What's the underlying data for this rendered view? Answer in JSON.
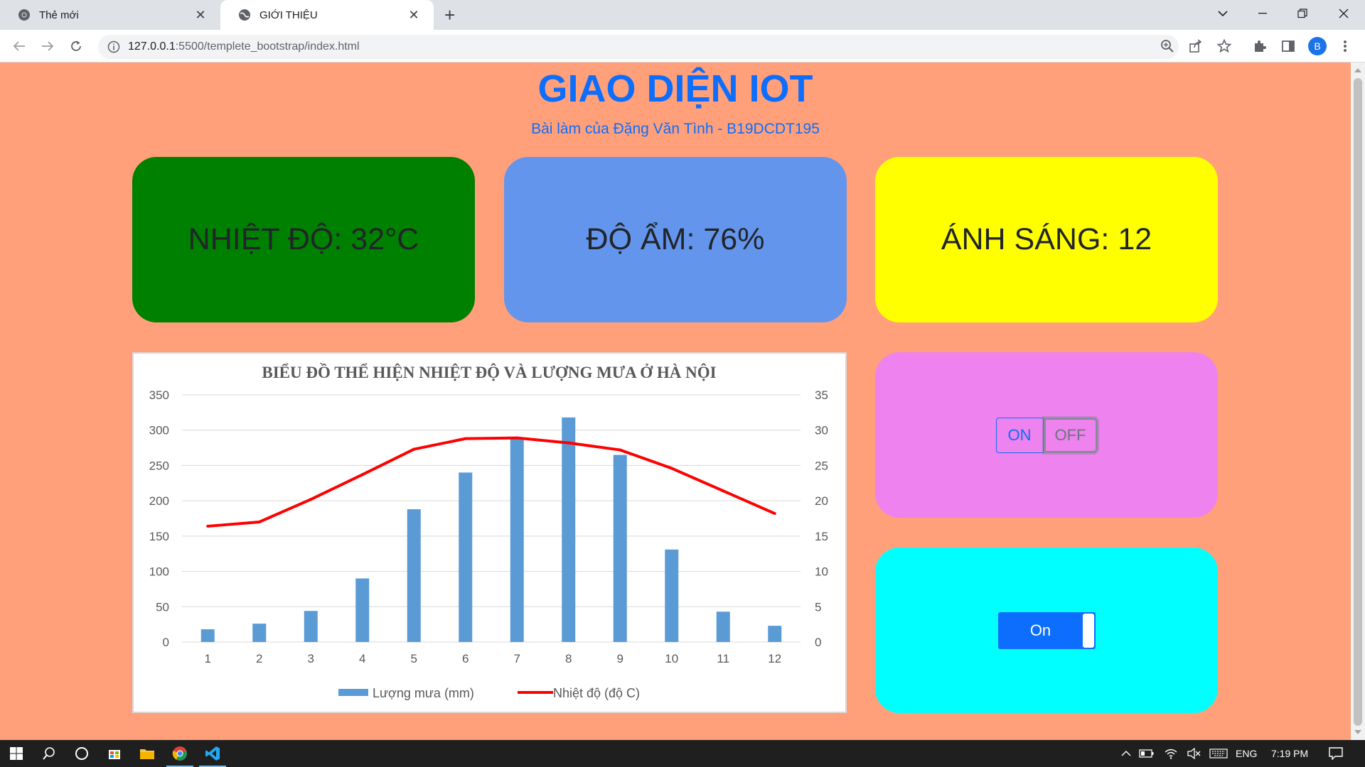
{
  "browser": {
    "tabs": [
      {
        "title": "Thẻ mới",
        "active": false
      },
      {
        "title": "GIỚI THIỆU",
        "active": true
      }
    ],
    "url_host": "127.0.0.1",
    "url_rest": ":5500/templete_bootstrap/index.html",
    "profile_initial": "B"
  },
  "page": {
    "title": "GIAO DIỆN IOT",
    "subtitle": "Bài làm của Đặng Văn Tình - B19DCDT195"
  },
  "cards": {
    "temperature": "NHIỆT ĐỘ: 32°C",
    "humidity": "ĐỘ ẨM: 76%",
    "light": "ÁNH SÁNG: 12"
  },
  "controls": {
    "on_label": "ON",
    "off_label": "OFF",
    "toggle_label": "On"
  },
  "chart_data": {
    "type": "bar+line",
    "title": "BIỂU ĐỒ  THỂ HIỆN NHIỆT ĐỘ VÀ LƯỢNG MƯA Ở HÀ NỘI",
    "categories": [
      "1",
      "2",
      "3",
      "4",
      "5",
      "6",
      "7",
      "8",
      "9",
      "10",
      "11",
      "12"
    ],
    "series": [
      {
        "name": "Lượng mưa (mm)",
        "kind": "bar",
        "axis": "left",
        "color": "#5b9bd5",
        "values": [
          18,
          26,
          44,
          90,
          188,
          240,
          288,
          318,
          265,
          131,
          43,
          23
        ]
      },
      {
        "name": "Nhiệt độ (độ C)",
        "kind": "line",
        "axis": "right",
        "color": "#ff0000",
        "values": [
          16.4,
          17.0,
          20.2,
          23.7,
          27.3,
          28.8,
          28.9,
          28.2,
          27.2,
          24.6,
          21.4,
          18.2
        ]
      }
    ],
    "y_left": {
      "min": 0,
      "max": 350,
      "ticks": [
        "0",
        "50",
        "100",
        "150",
        "200",
        "250",
        "300",
        "350"
      ]
    },
    "y_right": {
      "min": 0,
      "max": 35,
      "ticks": [
        "0",
        "5",
        "10",
        "15",
        "20",
        "25",
        "30",
        "35"
      ]
    },
    "grid": true,
    "legend_position": "bottom"
  },
  "taskbar": {
    "lang": "ENG",
    "time": "7:19 PM"
  }
}
